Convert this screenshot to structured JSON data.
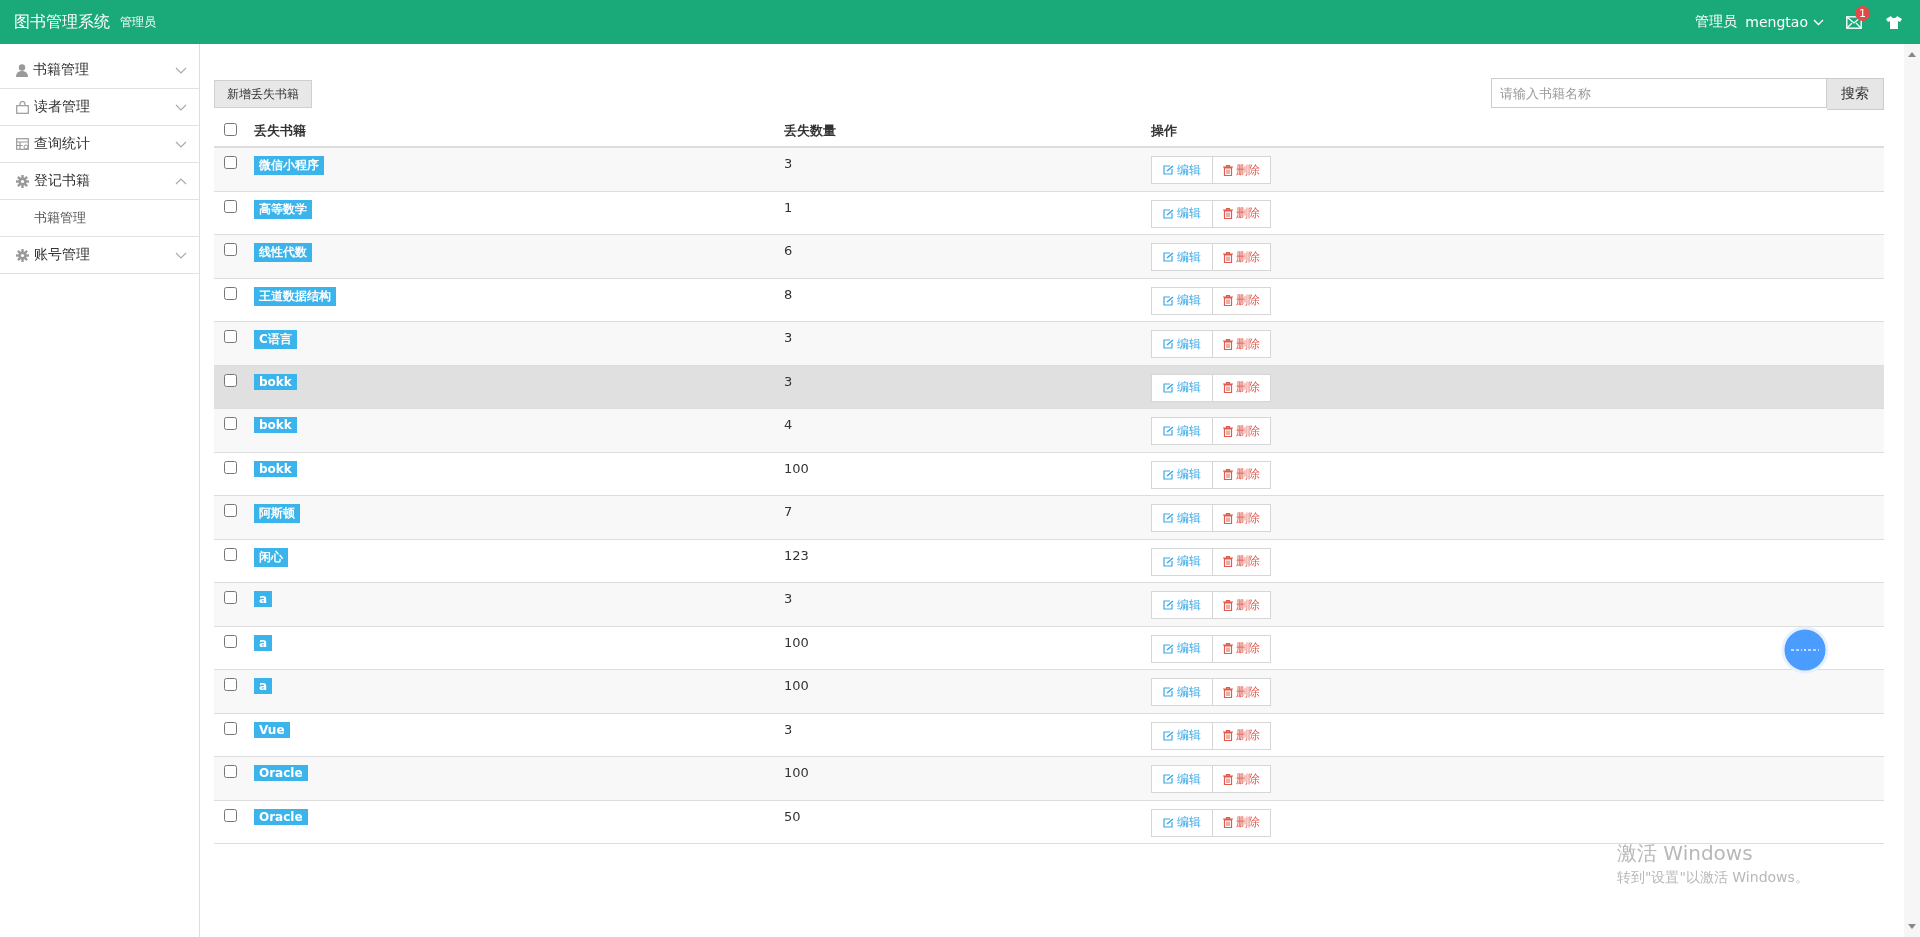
{
  "header": {
    "title": "图书管理系统",
    "subtitle": "管理员",
    "role": "管理员",
    "username": "mengtao",
    "message_count": "1"
  },
  "sidebar": {
    "items": [
      {
        "label": "书籍管理",
        "kind": "user",
        "expanded": false
      },
      {
        "label": "读者管理",
        "kind": "bag",
        "expanded": false
      },
      {
        "label": "查询统计",
        "kind": "table",
        "expanded": false
      },
      {
        "label": "登记书籍",
        "kind": "gear",
        "expanded": true,
        "children": [
          {
            "label": "书籍管理"
          }
        ]
      },
      {
        "label": "账号管理",
        "kind": "gear",
        "expanded": false
      }
    ]
  },
  "toolbar": {
    "add_button": "新增丢失书籍",
    "search": {
      "placeholder": "请输入书籍名称",
      "button": "搜索"
    }
  },
  "table": {
    "columns": [
      "丢失书籍",
      "丢失数量",
      "操作"
    ],
    "header_checked": false,
    "rows": [
      {
        "book": "微信小程序",
        "count": "3",
        "checked": false,
        "highlighted": false,
        "edit_label": "编辑",
        "delete_label": "删除"
      },
      {
        "book": "高等数学",
        "count": "1",
        "checked": false,
        "highlighted": false,
        "edit_label": "编辑",
        "delete_label": "删除"
      },
      {
        "book": "线性代数",
        "count": "6",
        "checked": false,
        "highlighted": false,
        "edit_label": "编辑",
        "delete_label": "删除"
      },
      {
        "book": "王道数据结构",
        "count": "8",
        "checked": false,
        "highlighted": false,
        "edit_label": "编辑",
        "delete_label": "删除"
      },
      {
        "book": "C语言",
        "count": "3",
        "checked": false,
        "highlighted": false,
        "edit_label": "编辑",
        "delete_label": "删除"
      },
      {
        "book": "bokk",
        "count": "3",
        "checked": false,
        "highlighted": true,
        "edit_label": "编辑",
        "delete_label": "删除"
      },
      {
        "book": "bokk",
        "count": "4",
        "checked": false,
        "highlighted": false,
        "edit_label": "编辑",
        "delete_label": "删除"
      },
      {
        "book": "bokk",
        "count": "100",
        "checked": false,
        "highlighted": false,
        "edit_label": "编辑",
        "delete_label": "删除"
      },
      {
        "book": "阿斯顿",
        "count": "7",
        "checked": false,
        "highlighted": false,
        "edit_label": "编辑",
        "delete_label": "删除"
      },
      {
        "book": "闲心",
        "count": "123",
        "checked": false,
        "highlighted": false,
        "edit_label": "编辑",
        "delete_label": "删除"
      },
      {
        "book": "a",
        "count": "3",
        "checked": false,
        "highlighted": false,
        "edit_label": "编辑",
        "delete_label": "删除"
      },
      {
        "book": "a",
        "count": "100",
        "checked": false,
        "highlighted": false,
        "edit_label": "编辑",
        "delete_label": "删除"
      },
      {
        "book": "a",
        "count": "100",
        "checked": false,
        "highlighted": false,
        "edit_label": "编辑",
        "delete_label": "删除"
      },
      {
        "book": "Vue",
        "count": "3",
        "checked": false,
        "highlighted": false,
        "edit_label": "编辑",
        "delete_label": "删除"
      },
      {
        "book": "Oracle",
        "count": "100",
        "checked": false,
        "highlighted": false,
        "edit_label": "编辑",
        "delete_label": "删除"
      },
      {
        "book": "Oracle",
        "count": "50",
        "checked": false,
        "highlighted": false,
        "edit_label": "编辑",
        "delete_label": "删除"
      }
    ]
  },
  "activation": {
    "title": "激活 Windows",
    "hint": "转到\"设置\"以激活 Windows。"
  }
}
